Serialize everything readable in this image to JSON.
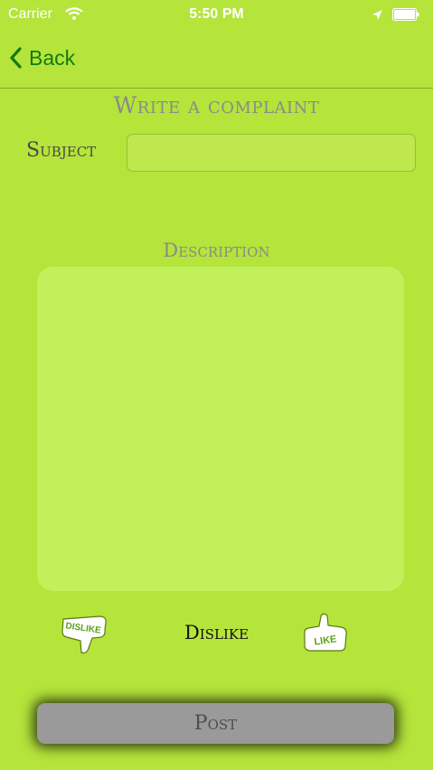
{
  "status_bar": {
    "carrier": "Carrier",
    "time": "5:50 PM"
  },
  "nav": {
    "back_label": "Back"
  },
  "form": {
    "title": "Write a complaint",
    "subject_label": "Subject",
    "subject_value": "",
    "description_label": "Description",
    "description_value": ""
  },
  "reaction": {
    "dislike_icon_text": "DISLIKE",
    "like_icon_text": "LIKE",
    "current_label": "Dislike"
  },
  "actions": {
    "post_label": "Post"
  },
  "colors": {
    "background": "#b5e43b",
    "accent": "#137a12",
    "description_bg": "#c2f05a"
  }
}
